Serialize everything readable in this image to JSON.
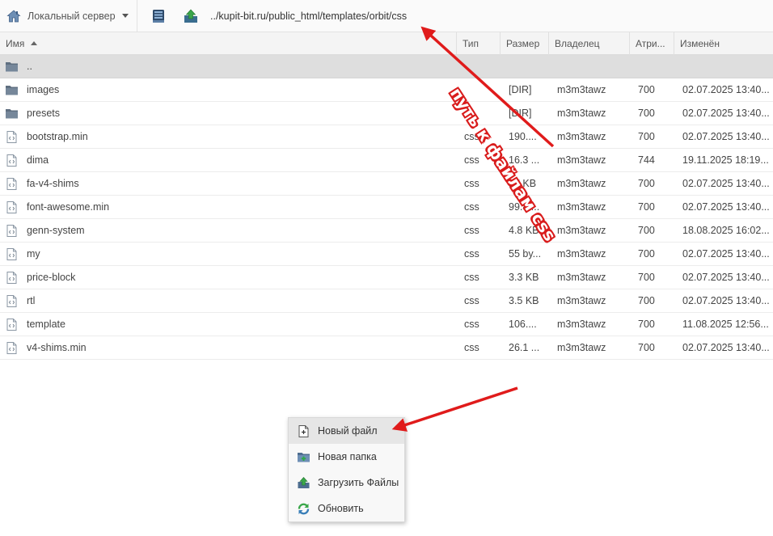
{
  "toolbar": {
    "server_label": "Локальный сервер",
    "path": "../kupit-bit.ru/public_html/templates/orbit/css"
  },
  "columns": {
    "name": "Имя",
    "type": "Тип",
    "size": "Размер",
    "owner": "Владелец",
    "attr": "Атри...",
    "modified": "Изменён"
  },
  "rows": [
    {
      "name": "..",
      "type": "",
      "size": "",
      "owner": "",
      "attr": "",
      "modified": "",
      "icon": "folder-icon",
      "selected": true
    },
    {
      "name": "images",
      "type": "",
      "size": "[DIR]",
      "owner": "m3m3tawz",
      "attr": "700",
      "modified": "02.07.2025 13:40...",
      "icon": "folder-icon"
    },
    {
      "name": "presets",
      "type": "",
      "size": "[DIR]",
      "owner": "m3m3tawz",
      "attr": "700",
      "modified": "02.07.2025 13:40...",
      "icon": "folder-icon"
    },
    {
      "name": "bootstrap.min",
      "type": "css",
      "size": "190....",
      "owner": "m3m3tawz",
      "attr": "700",
      "modified": "02.07.2025 13:40...",
      "icon": "code-file-icon"
    },
    {
      "name": "dima",
      "type": "css",
      "size": "16.3 ...",
      "owner": "m3m3tawz",
      "attr": "744",
      "modified": "19.11.2025 18:19...",
      "icon": "code-file-icon"
    },
    {
      "name": "fa-v4-shims",
      "type": "css",
      "size": "17 KB",
      "owner": "m3m3tawz",
      "attr": "700",
      "modified": "02.07.2025 13:40...",
      "icon": "code-file-icon"
    },
    {
      "name": "font-awesome.min",
      "type": "css",
      "size": "99.8 ...",
      "owner": "m3m3tawz",
      "attr": "700",
      "modified": "02.07.2025 13:40...",
      "icon": "code-file-icon"
    },
    {
      "name": "genn-system",
      "type": "css",
      "size": "4.8 KB",
      "owner": "m3m3tawz",
      "attr": "700",
      "modified": "18.08.2025 16:02...",
      "icon": "code-file-icon"
    },
    {
      "name": "my",
      "type": "css",
      "size": "55 by...",
      "owner": "m3m3tawz",
      "attr": "700",
      "modified": "02.07.2025 13:40...",
      "icon": "code-file-icon"
    },
    {
      "name": "price-block",
      "type": "css",
      "size": "3.3 KB",
      "owner": "m3m3tawz",
      "attr": "700",
      "modified": "02.07.2025 13:40...",
      "icon": "code-file-icon"
    },
    {
      "name": "rtl",
      "type": "css",
      "size": "3.5 KB",
      "owner": "m3m3tawz",
      "attr": "700",
      "modified": "02.07.2025 13:40...",
      "icon": "code-file-icon"
    },
    {
      "name": "template",
      "type": "css",
      "size": "106....",
      "owner": "m3m3tawz",
      "attr": "700",
      "modified": "11.08.2025 12:56...",
      "icon": "code-file-icon"
    },
    {
      "name": "v4-shims.min",
      "type": "css",
      "size": "26.1 ...",
      "owner": "m3m3tawz",
      "attr": "700",
      "modified": "02.07.2025 13:40...",
      "icon": "code-file-icon"
    }
  ],
  "context_menu": {
    "new_file": "Новый файл",
    "new_folder": "Новая папка",
    "upload": "Загрузить Файлы",
    "refresh": "Обновить"
  },
  "annotation": {
    "text": "путь к файлам css",
    "color": "#d91c1c"
  }
}
